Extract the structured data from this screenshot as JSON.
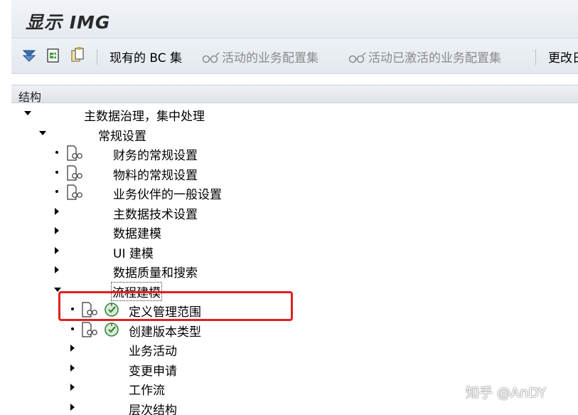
{
  "window": {
    "title": "显示 IMG"
  },
  "toolbar": {
    "bc_sets_label": "现有的 BC 集",
    "active_bc_sets_label": "活动的业务配置集",
    "activated_bc_sets_label": "活动已激活的业务配置集",
    "change_log_label": "更改日"
  },
  "structure": {
    "header": "结构"
  },
  "tree": {
    "root": "主数据治理，集中处理",
    "general_settings": "常规设置",
    "finance_settings": "财务的常规设置",
    "material_settings": "物料的常规设置",
    "partner_settings": "业务伙伴的一般设置",
    "technical_settings": "主数据技术设置",
    "data_modeling": "数据建模",
    "ui_modeling": "UI 建模",
    "data_quality": "数据质量和搜索",
    "process_modeling": "流程建模",
    "define_scope": "定义管理范围",
    "create_edition_type": "创建版本类型",
    "business_activities": "业务活动",
    "change_requests": "变更申请",
    "workflow": "工作流",
    "hierarchy": "层次结构"
  },
  "watermark": "知乎 @AnDY",
  "colors": {
    "highlight": "#e02020",
    "accent_green": "#2f8a3a",
    "toolbar_bg": "#e6ebf1"
  }
}
